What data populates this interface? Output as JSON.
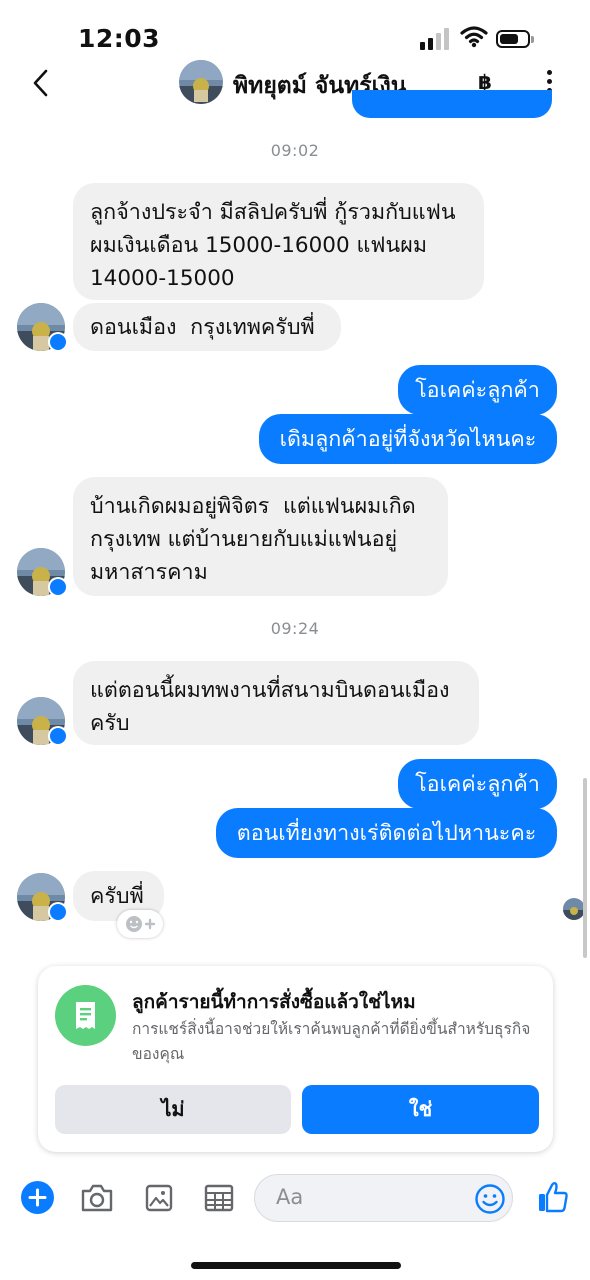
{
  "status_bar": {
    "time": "12:03"
  },
  "header": {
    "contact_name": "พิทยุตม์ จันทร์เงิน",
    "currency_symbol": "฿"
  },
  "timestamps": [
    "09:02",
    "09:24"
  ],
  "messages": [
    {
      "direction": "in",
      "text": "ลูกจ้างประจำ มีสลิปครับพี่ กู้รวมกับแฟน\nผมเงินเดือน 15000-16000 แฟนผม\n14000-15000"
    },
    {
      "direction": "in",
      "text": "ดอนเมือง  กรุงเทพครับพี่"
    },
    {
      "direction": "out",
      "text": "โอเคค่ะลูกค้า"
    },
    {
      "direction": "out",
      "text": "เดิมลูกค้าอยู่ที่จังหวัดไหนคะ"
    },
    {
      "direction": "in",
      "text": "บ้านเกิดผมอยู่พิจิตร  แต่แฟนผมเกิด\nกรุงเทพ แต่บ้านยายกับแม่แฟนอยู่\nมหาสารคาม"
    },
    {
      "direction": "in",
      "text": "แต่ตอนนี้ผมทพงานที่สนามบินดอนเมือง\nครับ"
    },
    {
      "direction": "out",
      "text": "โอเคค่ะลูกค้า"
    },
    {
      "direction": "out",
      "text": "ตอนเที่ยงทางเร่ติดต่อไปหานะคะ"
    },
    {
      "direction": "in",
      "text": "ครับพี่"
    }
  ],
  "order_prompt": {
    "title": "ลูกค้ารายนี้ทำการสั่งซื้อแล้วใช่ไหม",
    "description": "การแชร์สิ่งนี้อาจช่วยให้เราค้นพบลูกค้าที่ดียิ่งขึ้นสำหรับธุรกิจของคุณ",
    "no_label": "ไม่",
    "yes_label": "ใช่"
  },
  "composer": {
    "placeholder": "Aa"
  },
  "colors": {
    "accent": "#0a7cff",
    "incoming_bubble": "#f0f0f0",
    "receipt_icon_bg": "#5bd07e"
  }
}
